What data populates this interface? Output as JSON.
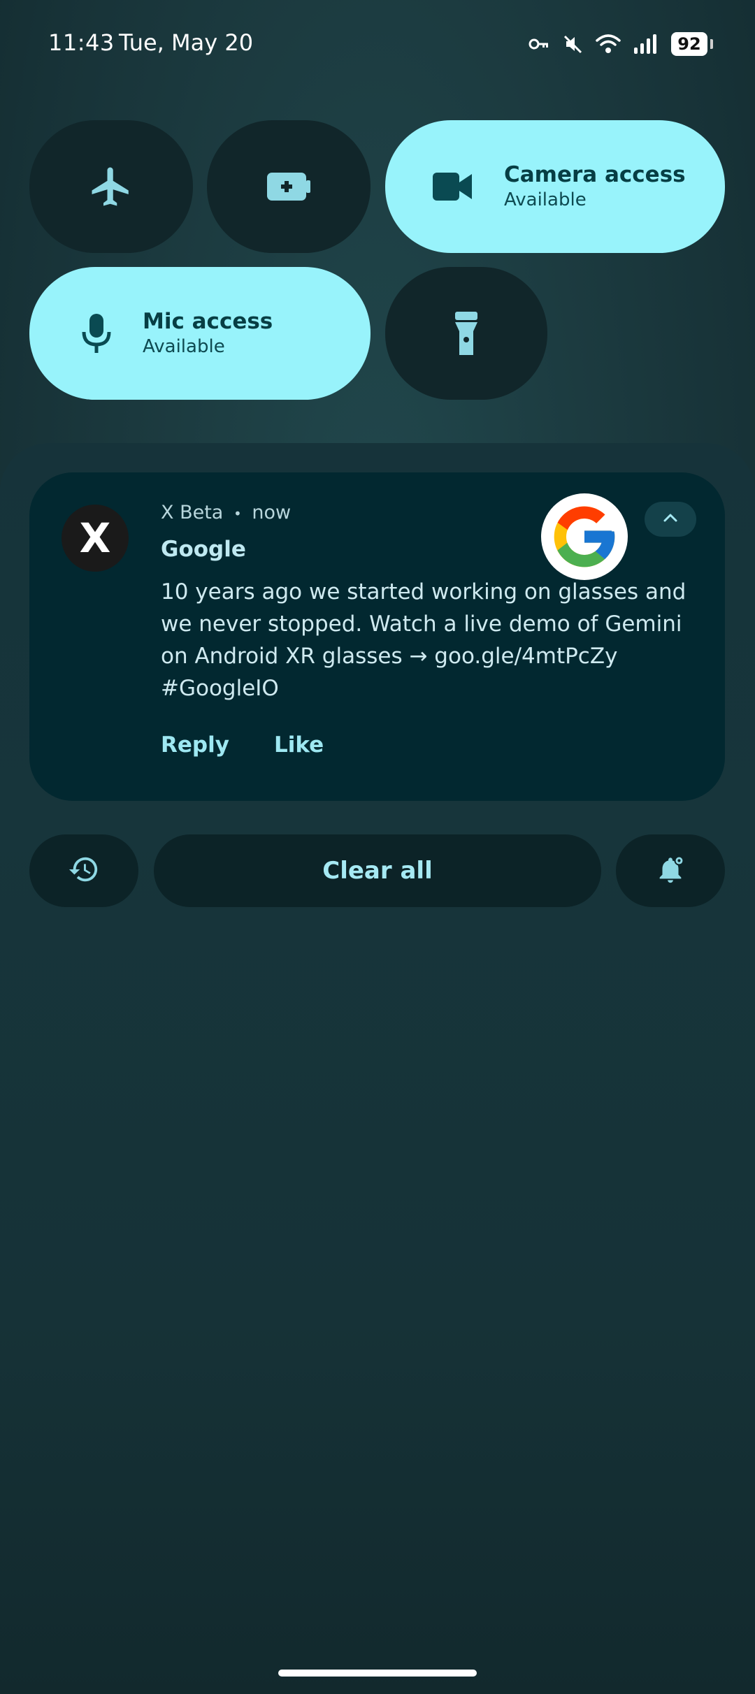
{
  "status_bar": {
    "time": "11:43",
    "date": "Tue, May 20",
    "battery_level": "92",
    "icons": [
      "vpn-key-icon",
      "muted-icon",
      "wifi-icon",
      "signal-icon",
      "battery-icon"
    ]
  },
  "quick_settings": {
    "tiles": [
      {
        "name": "airplane-mode",
        "icon": "airplane-icon",
        "state": "off"
      },
      {
        "name": "battery-saver",
        "icon": "battery-plus-icon",
        "state": "off"
      },
      {
        "name": "camera-access",
        "icon": "video-camera-icon",
        "state": "on",
        "title": "Camera access",
        "subtitle": "Available"
      },
      {
        "name": "mic-access",
        "icon": "microphone-icon",
        "state": "on",
        "title": "Mic access",
        "subtitle": "Available"
      },
      {
        "name": "flashlight",
        "icon": "flashlight-icon",
        "state": "off"
      }
    ]
  },
  "notification": {
    "app_icon_letter": "X",
    "app_name": "X Beta",
    "separator": "•",
    "time": "now",
    "title": "Google",
    "body": "10 years ago we started working on glasses and we never stopped. Watch a live demo of Gemini on Android XR glasses → goo.gle/4mtPcZy #GoogleIO",
    "actions": {
      "reply": "Reply",
      "like": "Like"
    },
    "large_icon": "google-g-logo"
  },
  "shade_controls": {
    "history_icon": "history-icon",
    "clear_all": "Clear all",
    "settings_icon": "notification-settings-icon"
  },
  "colors": {
    "tile_active": "#98f3fb",
    "tile_inactive": "#11262a",
    "notification_bg": "#022830",
    "accent_text": "#9ee8f2"
  }
}
